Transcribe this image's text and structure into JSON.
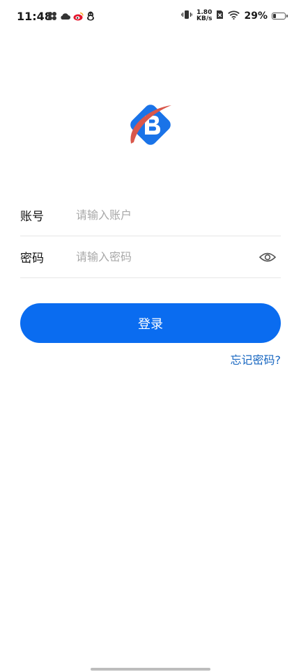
{
  "status_bar": {
    "time": "11:48",
    "net_speed_value": "1.80",
    "net_speed_unit": "KB/s",
    "battery_percent": "29%",
    "battery_level": 0.29,
    "icons_left": [
      "pinwheel-icon",
      "cloud-icon",
      "weibo-icon",
      "qq-penguin-icon"
    ],
    "icons_right": [
      "vibrate-icon",
      "sim-off-icon",
      "wifi-icon",
      "battery-icon"
    ]
  },
  "logo": {
    "icon": "app-logo-icon",
    "colors": {
      "primary": "#1a73e8",
      "accent": "#d9574b"
    }
  },
  "form": {
    "account": {
      "label": "账号",
      "placeholder": "请输入账户",
      "value": ""
    },
    "password": {
      "label": "密码",
      "placeholder": "请输入密码",
      "value": "",
      "toggle_icon": "eye-icon"
    }
  },
  "actions": {
    "login_label": "登录",
    "forgot_label": "忘记密码?"
  },
  "colors": {
    "accent": "#0a6cf0",
    "link": "#1565c0",
    "placeholder": "#a8a8a8",
    "divider": "#e6e6e6"
  }
}
